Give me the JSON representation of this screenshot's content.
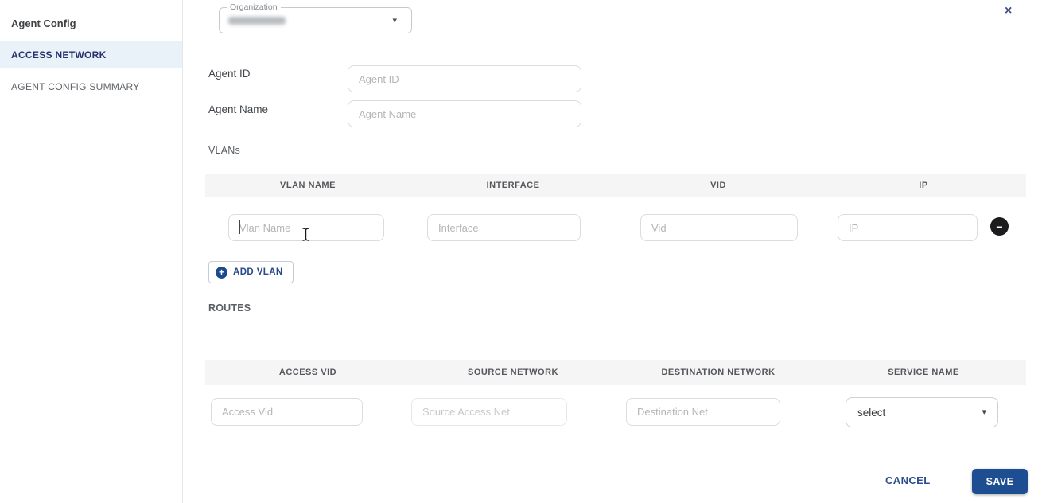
{
  "dialog": {
    "title": "Agent Config"
  },
  "icons": {
    "close": "×",
    "plus": "+",
    "minus": "−",
    "caret_down": "▾"
  },
  "sidebar": {
    "items": [
      {
        "label": "ACCESS NETWORK",
        "selected": true
      },
      {
        "label": "AGENT CONFIG SUMMARY",
        "selected": false
      }
    ]
  },
  "organization": {
    "label": "Organization",
    "value": "",
    "value_redacted": true
  },
  "form": {
    "agent_id": {
      "label": "Agent ID",
      "placeholder": "Agent ID",
      "value": ""
    },
    "agent_name": {
      "label": "Agent Name",
      "placeholder": "Agent Name",
      "value": ""
    }
  },
  "vlans": {
    "section_label": "VLANs",
    "columns": [
      "VLAN NAME",
      "INTERFACE",
      "VID",
      "IP"
    ],
    "placeholders": [
      "Vlan Name",
      "Interface",
      "Vid",
      "IP"
    ],
    "add_button": {
      "label": "ADD VLAN"
    }
  },
  "routes": {
    "section_label": "ROUTES",
    "columns": [
      "ACCESS VID",
      "SOURCE NETWORK",
      "DESTINATION NETWORK",
      "SERVICE NAME"
    ],
    "placeholders": [
      "Access Vid",
      "Source Access Net",
      "Destination Net"
    ],
    "select_value": "select"
  },
  "footer": {
    "cancel_label": "CANCEL",
    "save_label": "SAVE"
  },
  "colors": {
    "primary": "#1d4e91",
    "selected_item_bg": "#e9f1f9",
    "selected_item_text": "#27316b",
    "header_band": "#f6f5f5",
    "remove_button": "#1c1c1e"
  }
}
